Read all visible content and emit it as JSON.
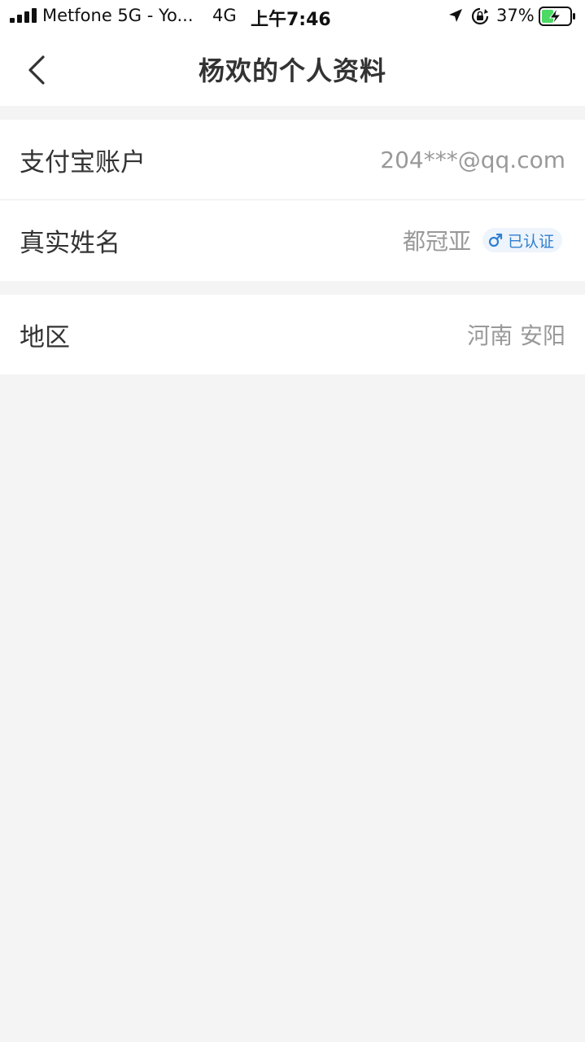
{
  "status_bar": {
    "carrier": "Metfone 5G - Yo...",
    "network": "4G",
    "time": "上午7:46",
    "battery": "37%"
  },
  "nav": {
    "title": "杨欢的个人资料"
  },
  "profile": {
    "alipay": {
      "label": "支付宝账户",
      "value": "204***@qq.com"
    },
    "real_name": {
      "label": "真实姓名",
      "value": "都冠亚",
      "badge": "已认证"
    },
    "region": {
      "label": "地区",
      "value": "河南 安阳"
    }
  },
  "colors": {
    "badge_text": "#2f7fd1",
    "badge_bg": "#eef4fb",
    "battery_fill": "#4cd964"
  },
  "icons": {
    "back": "back-chevron-icon",
    "gender": "male-icon",
    "location": "location-arrow-icon",
    "orientation_lock": "orientation-lock-icon",
    "battery": "battery-charging-icon"
  }
}
